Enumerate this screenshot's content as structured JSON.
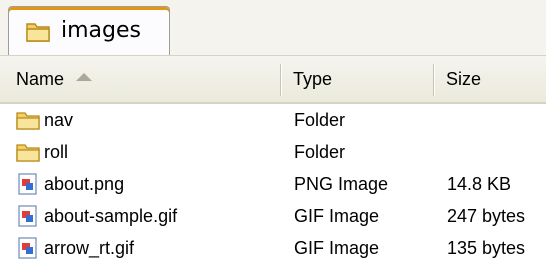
{
  "tab": {
    "label": "images",
    "icon": "folder-icon"
  },
  "columns": [
    {
      "label": "Name",
      "sorted": "ascending"
    },
    {
      "label": "Type"
    },
    {
      "label": "Size"
    }
  ],
  "rows": [
    {
      "name": "nav",
      "type": "Folder",
      "size": "",
      "icon": "folder-icon"
    },
    {
      "name": "roll",
      "type": "Folder",
      "size": "",
      "icon": "folder-icon"
    },
    {
      "name": "about.png",
      "type": "PNG Image",
      "size": "14.8 KB",
      "icon": "image-file-icon"
    },
    {
      "name": "about-sample.gif",
      "type": "GIF Image",
      "size": "247 bytes",
      "icon": "image-file-icon"
    },
    {
      "name": "arrow_rt.gif",
      "type": "GIF Image",
      "size": "135 bytes",
      "icon": "image-file-icon"
    }
  ],
  "colors": {
    "tab_accent": "#e69710",
    "folder": "#f3cf68",
    "header_bg": "#ebeadb"
  }
}
